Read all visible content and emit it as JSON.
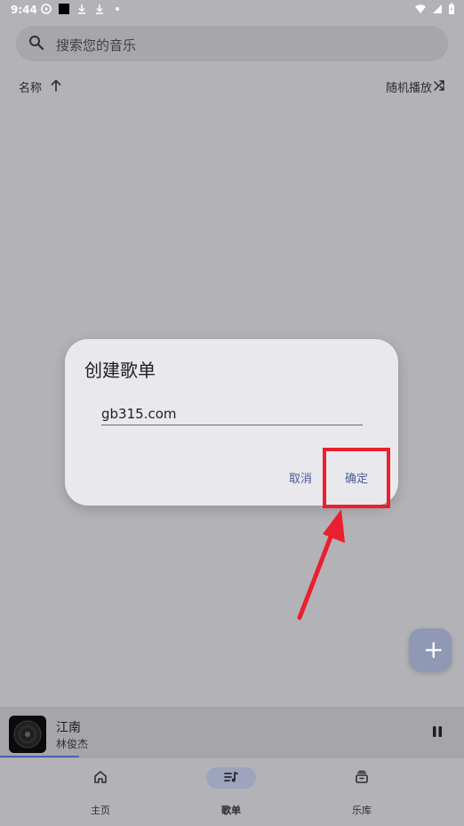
{
  "status_bar": {
    "time": "9:44"
  },
  "search": {
    "placeholder": "搜索您的音乐"
  },
  "sort": {
    "label": "名称",
    "shuffle_label": "随机播放"
  },
  "dialog": {
    "title": "创建歌单",
    "input_value": "gb315.com",
    "cancel_label": "取消",
    "confirm_label": "确定"
  },
  "player": {
    "title": "江南",
    "artist": "林俊杰"
  },
  "nav": {
    "items": [
      {
        "label": "主页",
        "icon": "home-icon"
      },
      {
        "label": "歌单",
        "icon": "playlist-icon"
      },
      {
        "label": "乐库",
        "icon": "library-icon"
      }
    ]
  },
  "fab": {
    "label": "+"
  },
  "colors": {
    "accent": "#4b5b9a",
    "highlight": "#ea1f2f",
    "arrow": "#ea1f2f"
  }
}
